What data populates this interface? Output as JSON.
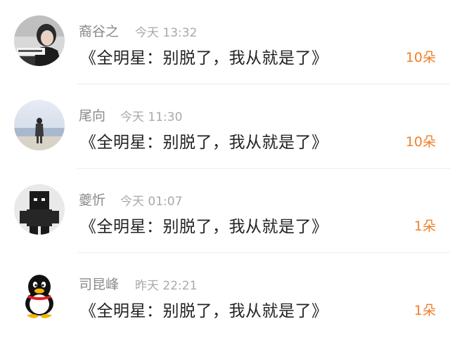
{
  "comments": [
    {
      "name": "裔谷之",
      "time": "今天 13:32",
      "title": "《全明星：别脱了，我从就是了》",
      "count": "10朵",
      "avatar_icon": "woman-photo-avatar"
    },
    {
      "name": "尾向",
      "time": "今天 11:30",
      "title": "《全明星：别脱了，我从就是了》",
      "count": "10朵",
      "avatar_icon": "seaside-girl-avatar"
    },
    {
      "name": "夔忻",
      "time": "今天 01:07",
      "title": "《全明星：别脱了，我从就是了》",
      "count": "1朵",
      "avatar_icon": "pixel-figure-avatar"
    },
    {
      "name": "司昆峰",
      "time": "昨天 22:21",
      "title": "《全明星：别脱了，我从就是了》",
      "count": "1朵",
      "avatar_icon": "penguin-avatar"
    }
  ],
  "colors": {
    "accent": "#ef7f2a",
    "name": "#8a8a8a",
    "time": "#a9a9a9",
    "title": "#222222"
  }
}
